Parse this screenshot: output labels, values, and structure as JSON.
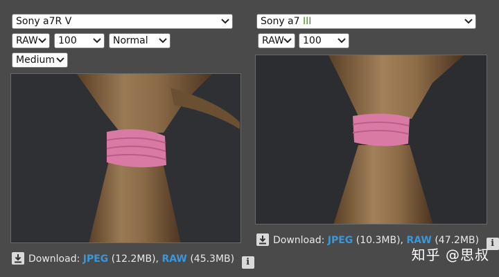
{
  "left": {
    "camera": {
      "name": "Sony a7R V",
      "suffix": ""
    },
    "format": "RAW",
    "iso": "100",
    "mode": "Normal",
    "quality": "Medium",
    "download": {
      "label": "Download:",
      "jpeg_label": "JPEG",
      "jpeg_size": "(12.2MB),",
      "raw_label": "RAW",
      "raw_size": "(45.3MB)",
      "info": "i"
    }
  },
  "right": {
    "camera": {
      "name": "Sony a7 ",
      "suffix": "III"
    },
    "format": "RAW",
    "iso": "100",
    "download": {
      "label": "Download:",
      "jpeg_label": "JPEG",
      "jpeg_size": "(10.3MB),",
      "raw_label": "RAW",
      "raw_size": "(47.2MB)",
      "info": "i"
    }
  },
  "watermark": "知乎 @思叔",
  "colors": {
    "background": "#4a4a4a",
    "link": "#3c97d9",
    "camera_suffix": "#4a8f1a",
    "hair_tie": "#d97aa4"
  },
  "icons": {
    "dropdown": "chevron-down-icon",
    "download": "download-icon",
    "info": "info-icon"
  }
}
